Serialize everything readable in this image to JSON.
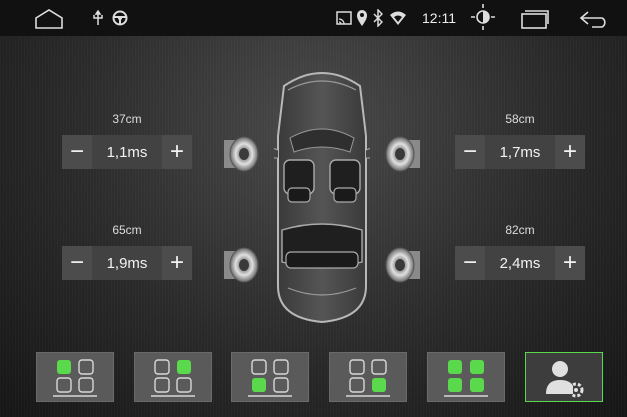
{
  "status_bar": {
    "time": "12:11",
    "icons": [
      "home-icon",
      "usb-icon",
      "steering-wheel-icon",
      "cast-icon",
      "location-icon",
      "bluetooth-icon",
      "wifi-icon",
      "brightness-icon",
      "recent-apps-icon",
      "back-icon"
    ]
  },
  "delays": {
    "front_left": {
      "distance": "37cm",
      "delay": "1,1ms"
    },
    "front_right": {
      "distance": "58cm",
      "delay": "1,7ms"
    },
    "rear_left": {
      "distance": "65cm",
      "delay": "1,9ms"
    },
    "rear_right": {
      "distance": "82cm",
      "delay": "2,4ms"
    },
    "minus_label": "−",
    "plus_label": "+"
  },
  "presets": [
    {
      "name": "front-left",
      "active_seats": [
        "FL"
      ]
    },
    {
      "name": "front-right",
      "active_seats": [
        "FR"
      ]
    },
    {
      "name": "rear-left",
      "active_seats": [
        "RL"
      ]
    },
    {
      "name": "rear-right",
      "active_seats": [
        "RR"
      ]
    },
    {
      "name": "all-seats",
      "active_seats": [
        "FL",
        "FR",
        "RL",
        "RR"
      ]
    },
    {
      "name": "custom",
      "icon": "user-settings-icon"
    }
  ],
  "colors": {
    "accent": "#5bd94c",
    "seat_inactive": "#d8d8d8"
  }
}
